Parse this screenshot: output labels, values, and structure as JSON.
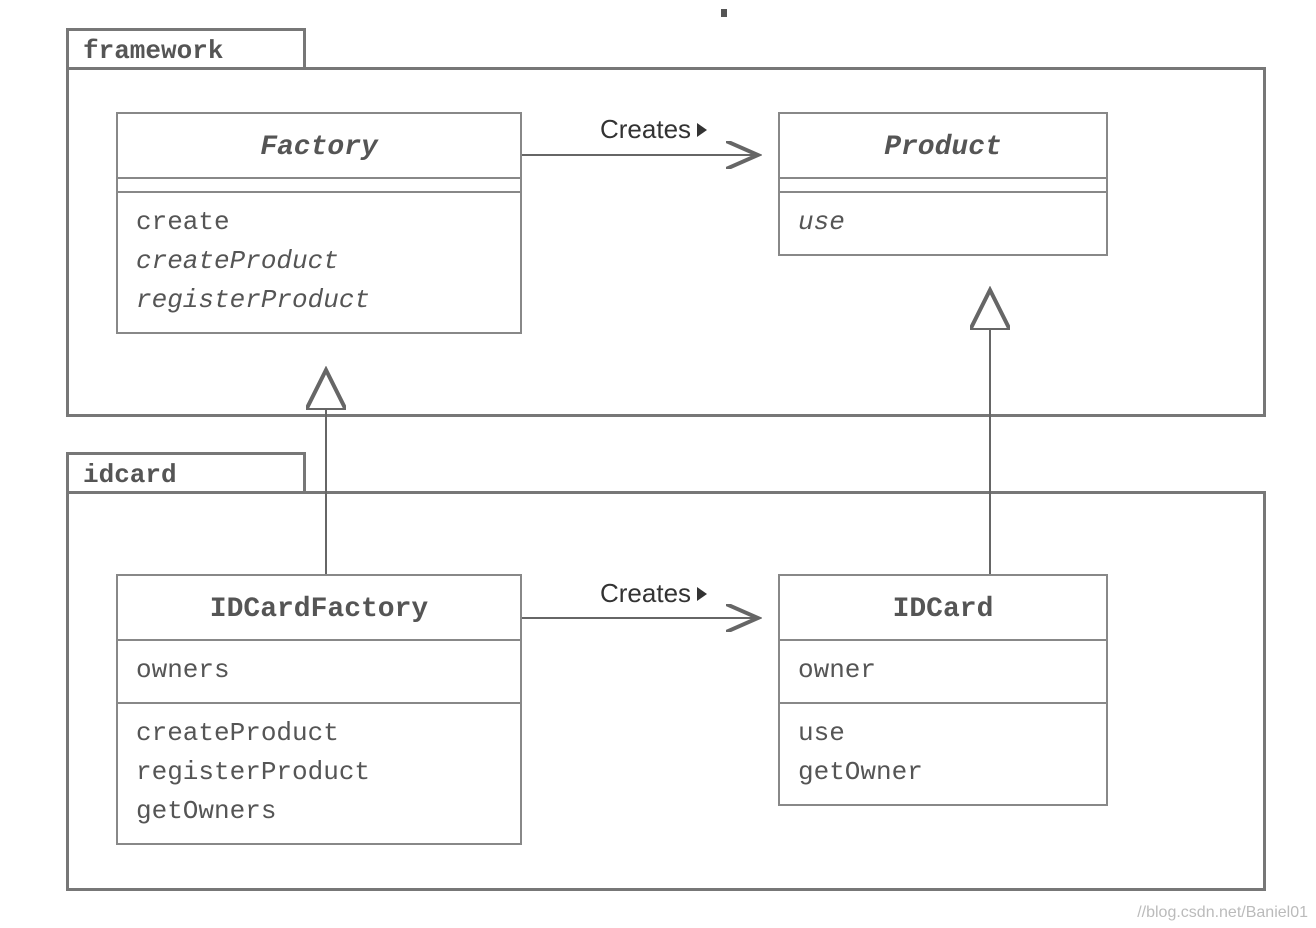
{
  "packages": {
    "framework": {
      "name": "framework"
    },
    "idcard": {
      "name": "idcard"
    }
  },
  "classes": {
    "factory": {
      "name": "Factory",
      "abstract": true,
      "attributes": [],
      "methods": [
        {
          "name": "create",
          "abstract": false
        },
        {
          "name": "createProduct",
          "abstract": true
        },
        {
          "name": "registerProduct",
          "abstract": true
        }
      ]
    },
    "product": {
      "name": "Product",
      "abstract": true,
      "attributes": [],
      "methods": [
        {
          "name": "use",
          "abstract": true
        }
      ]
    },
    "idcardfactory": {
      "name": "IDCardFactory",
      "abstract": false,
      "attributes": [
        {
          "name": "owners"
        }
      ],
      "methods": [
        {
          "name": "createProduct",
          "abstract": false
        },
        {
          "name": "registerProduct",
          "abstract": false
        },
        {
          "name": "getOwners",
          "abstract": false
        }
      ]
    },
    "idcard": {
      "name": "IDCard",
      "abstract": false,
      "attributes": [
        {
          "name": "owner"
        }
      ],
      "methods": [
        {
          "name": "use",
          "abstract": false
        },
        {
          "name": "getOwner",
          "abstract": false
        }
      ]
    }
  },
  "relations": {
    "creates_top": {
      "label": "Creates",
      "from": "factory",
      "to": "product",
      "type": "dependency"
    },
    "creates_bottom": {
      "label": "Creates",
      "from": "idcardfactory",
      "to": "idcard",
      "type": "dependency"
    },
    "inherit_factory": {
      "from": "idcardfactory",
      "to": "factory",
      "type": "generalization"
    },
    "inherit_product": {
      "from": "idcard",
      "to": "product",
      "type": "generalization"
    }
  },
  "watermark": "//blog.csdn.net/Baniel01"
}
